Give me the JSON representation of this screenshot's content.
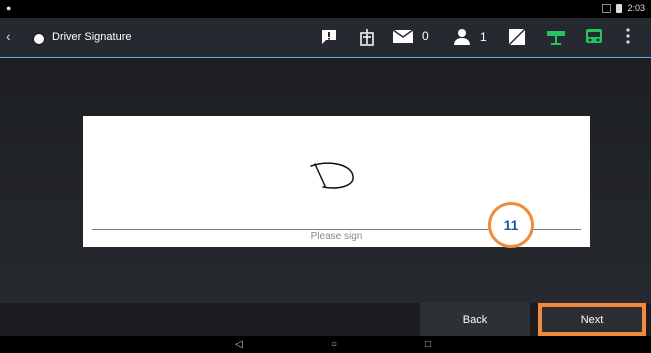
{
  "status": {
    "time": "2:03"
  },
  "toolbar": {
    "title": "Driver Signature",
    "messages_count": "0",
    "users_count": "1"
  },
  "signature": {
    "prompt": "Please sign",
    "drawn_initial": "D"
  },
  "annotation": {
    "step": "11"
  },
  "buttons": {
    "back": "Back",
    "next": "Next"
  },
  "colors": {
    "accent": "#5ab0e6",
    "highlight": "#f08a3c",
    "green": "#22c55e"
  }
}
